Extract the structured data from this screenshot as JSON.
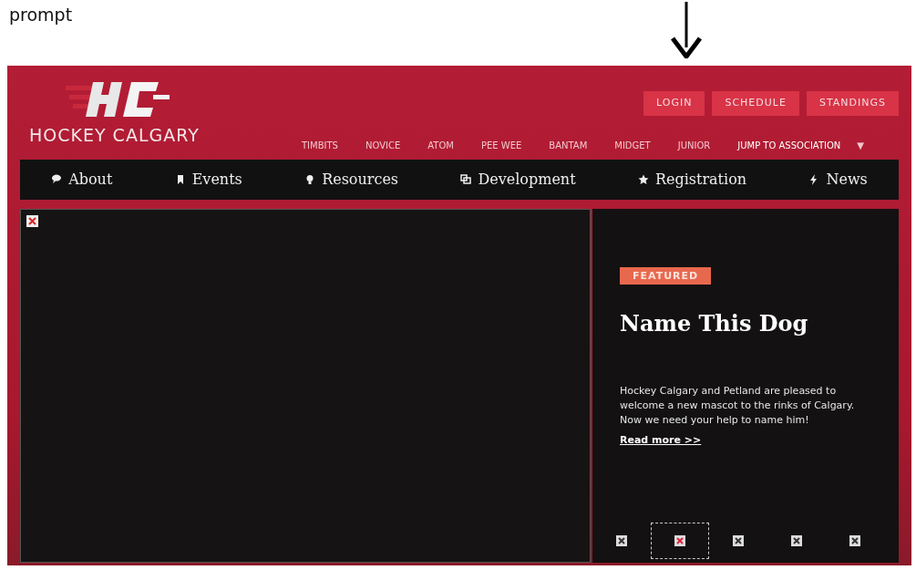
{
  "caption": "prompt",
  "header": {
    "brand": "HOCKEY CALGARY",
    "top_buttons": [
      "LOGIN",
      "SCHEDULE",
      "STANDINGS"
    ],
    "divisions": [
      "TIMBITS",
      "NOVICE",
      "ATOM",
      "PEE WEE",
      "BANTAM",
      "MIDGET",
      "JUNIOR"
    ],
    "jump": {
      "label": "JUMP TO ASSOCIATION",
      "caret": "▼"
    }
  },
  "nav": [
    {
      "label": "About",
      "kind": "chat"
    },
    {
      "label": "Events",
      "kind": "bookmark"
    },
    {
      "label": "Resources",
      "kind": "bulb"
    },
    {
      "label": "Development",
      "kind": "squares"
    },
    {
      "label": "Registration",
      "kind": "star"
    },
    {
      "label": "News",
      "kind": "bolt"
    }
  ],
  "featured": {
    "badge": "FEATURED",
    "title": "Name This Dog",
    "body": "Hockey Calgary and Petland are pleased to welcome a new mascot to the rinks of Calgary. Now we need your help to name him!",
    "link": "Read more >>"
  },
  "thumbnails": [
    {
      "selected": false
    },
    {
      "selected": true
    },
    {
      "selected": false
    },
    {
      "selected": false
    },
    {
      "selected": false
    }
  ]
}
